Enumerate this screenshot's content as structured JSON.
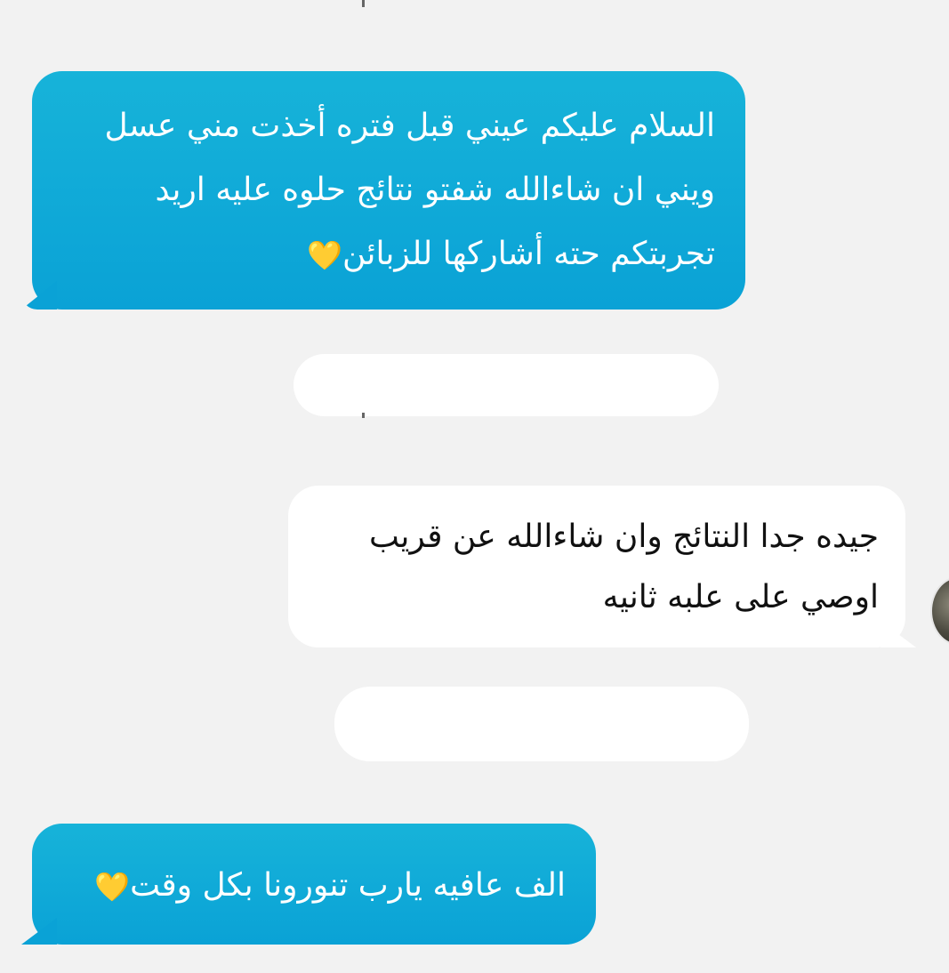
{
  "messages": [
    {
      "id": "msg1",
      "direction": "sent",
      "text": "السلام عليكم عيني قبل فتره أخذت مني عسل\nويني ان شاءالله شفتو نتائج حلوه عليه اريد\nتجربتكم حته أشاركها للزبائن",
      "emoji": "💛"
    },
    {
      "id": "msg2",
      "direction": "received",
      "text": "جيده جدا  النتائج وان شاءالله عن قريب\nاوصي على علبه ثانيه"
    },
    {
      "id": "msg3",
      "direction": "sent",
      "text": "الف عافيه يارب تنورونا  بكل وقت",
      "emoji": "💛"
    }
  ],
  "colors": {
    "sent_bubble": "#0aa2d6",
    "received_bubble": "#ffffff",
    "background": "#f2f2f2",
    "heart": "#f5b800"
  },
  "icons": {
    "heart": "yellow-heart-icon",
    "avatar": "avatar"
  }
}
